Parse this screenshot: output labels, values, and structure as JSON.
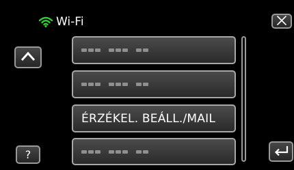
{
  "header": {
    "title": "Wi-Fi",
    "wifi_icon": "wifi-icon",
    "icon_color": "#33cc33"
  },
  "buttons": {
    "close_icon": "close-icon",
    "up_icon": "caret-up-icon",
    "help_label": "?",
    "back_icon": "return-arrow-icon"
  },
  "menu": {
    "items": [
      {
        "label": "",
        "masked": true
      },
      {
        "label": "",
        "masked": true
      },
      {
        "label": "ÉRZÉKEL. BEÁLL./MAIL",
        "masked": false
      },
      {
        "label": "",
        "masked": true
      }
    ]
  }
}
